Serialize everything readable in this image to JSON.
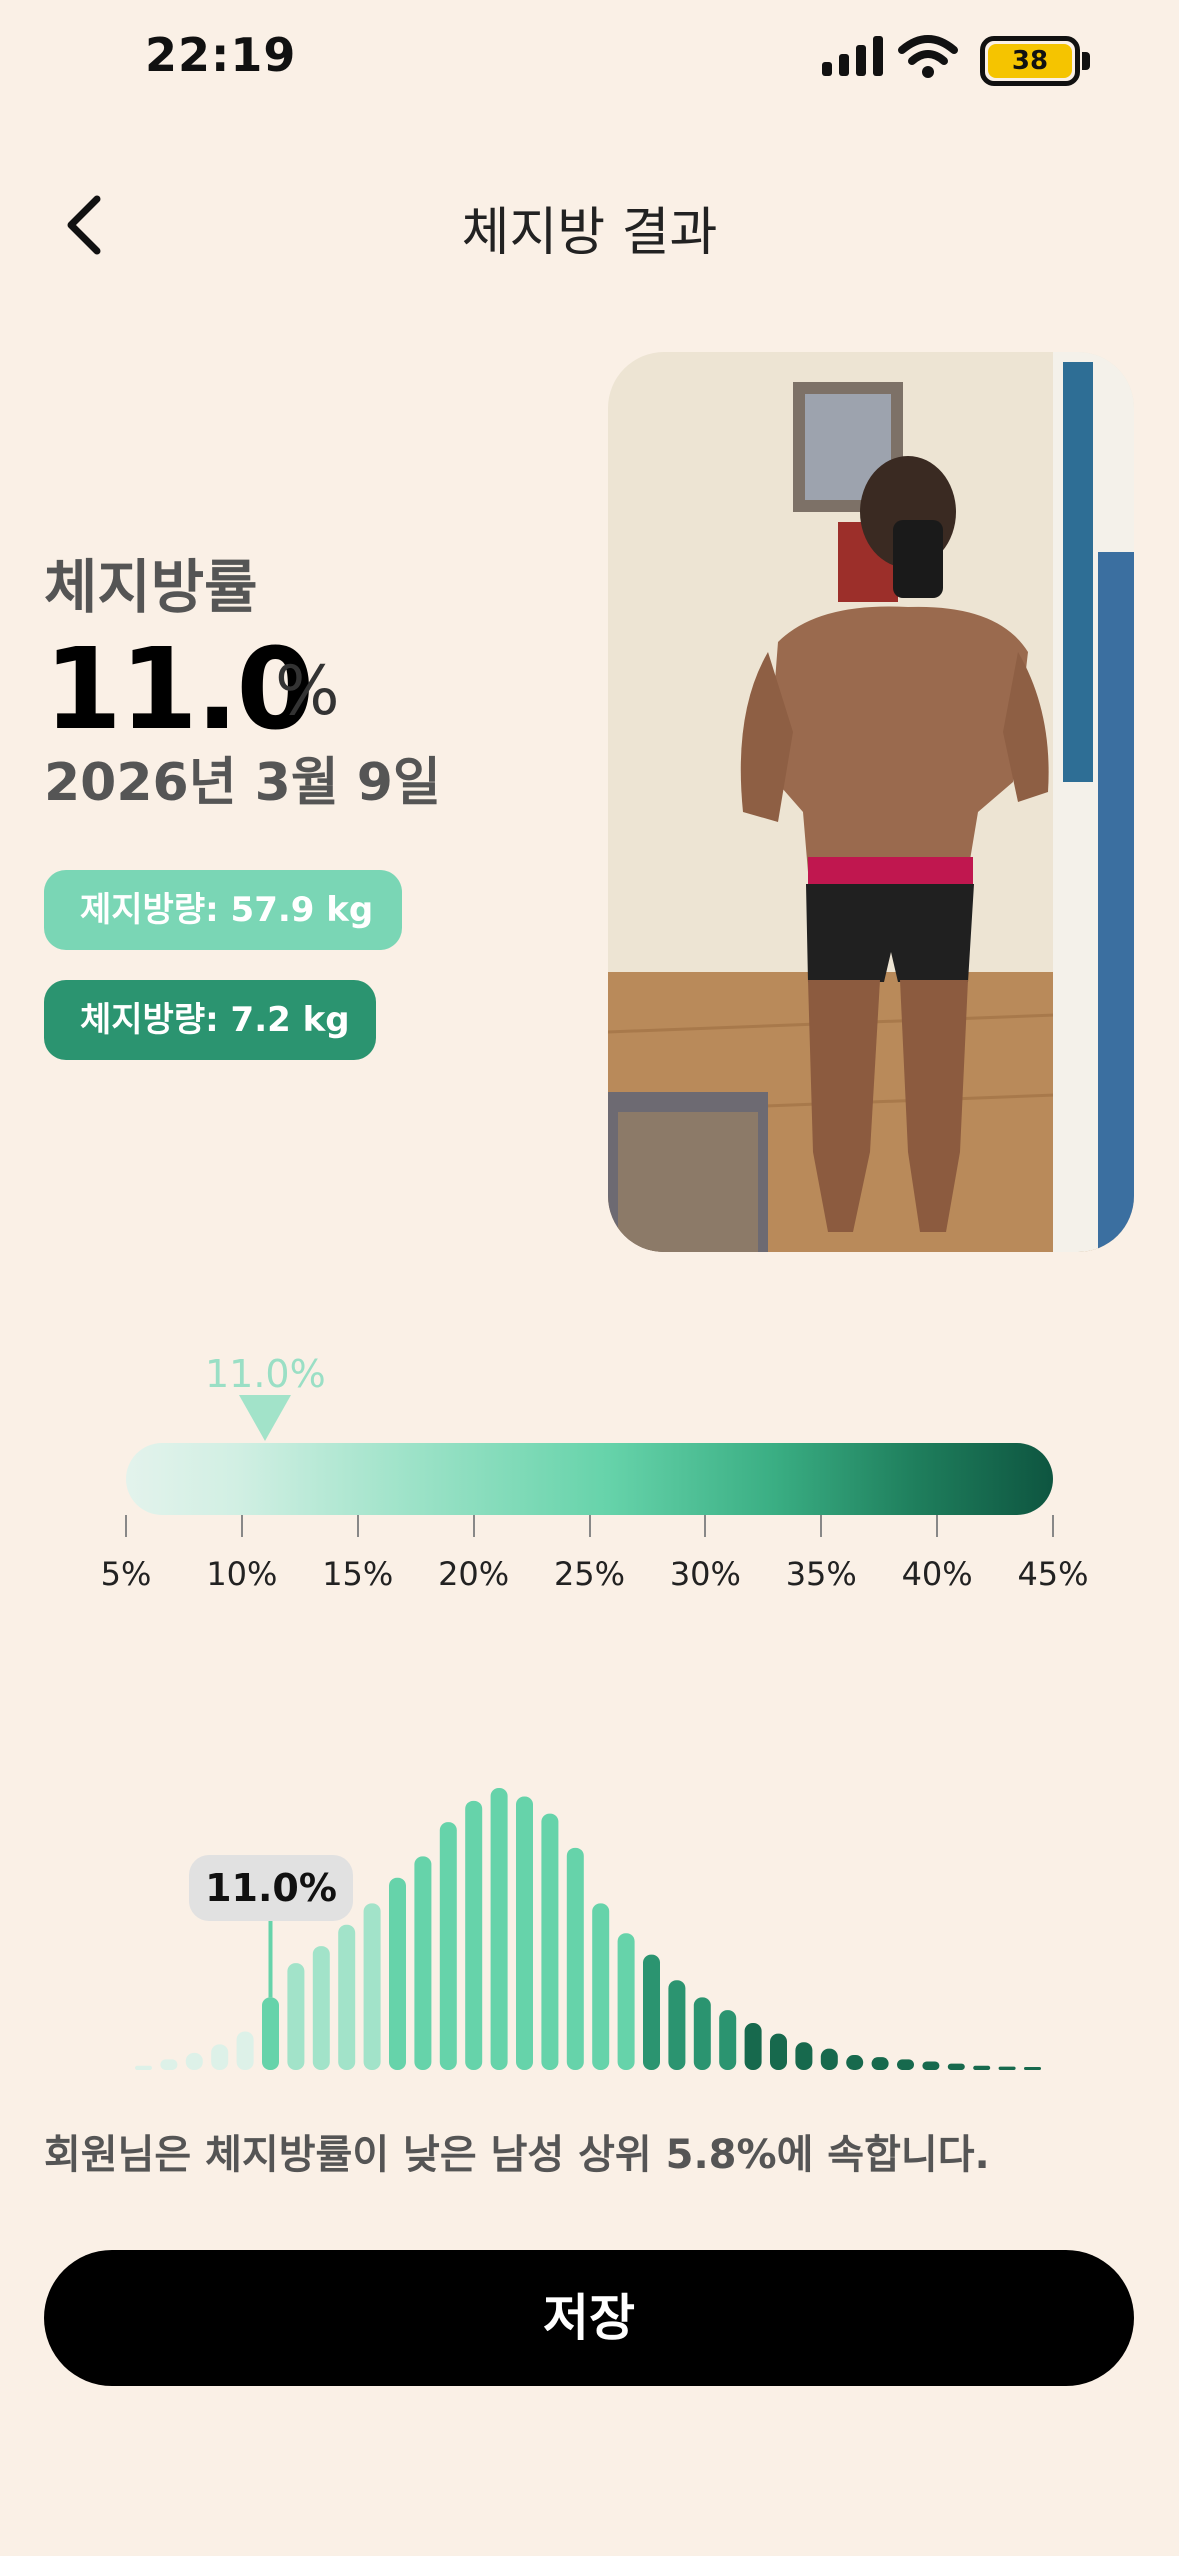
{
  "status_bar": {
    "time": "22:19",
    "battery_level": "38",
    "battery_color": "#F5C400"
  },
  "header": {
    "title": "체지방 결과",
    "back_icon": "chevron-left-icon"
  },
  "metric": {
    "label": "체지방률",
    "value": "11.0",
    "unit": "%",
    "date": "2026년 3월 9일"
  },
  "pills": {
    "lean_mass": "제지방량: 57.9 kg",
    "fat_mass": "체지방량: 7.2 kg",
    "lean_color": "#7AD6B5",
    "fat_color": "#2B9470"
  },
  "scale": {
    "marker_label": "11.0%",
    "marker_value": 11.0,
    "range": [
      5,
      45
    ],
    "ticks": [
      "5%",
      "10%",
      "15%",
      "20%",
      "25%",
      "30%",
      "35%",
      "40%",
      "45%"
    ]
  },
  "chart_data": {
    "type": "bar",
    "callout": "11.0%",
    "highlight_index": 5,
    "values": [
      2,
      5,
      8,
      12,
      18,
      34,
      50,
      58,
      68,
      78,
      90,
      100,
      116,
      126,
      132,
      128,
      120,
      104,
      78,
      64,
      54,
      42,
      34,
      28,
      22,
      17,
      13,
      10,
      7,
      6,
      5,
      4,
      3,
      2,
      1.6,
      1.2
    ],
    "colors": {
      "light": "#DDF1E8",
      "mid_light": "#A2E3C9",
      "mid": "#66D3AA",
      "dark": "#2B9470",
      "darkest": "#17694D"
    }
  },
  "summary": "회원님은 체지방률이 낮은 남성 상위 5.8%에 속합니다.",
  "actions": {
    "save_label": "저장"
  }
}
